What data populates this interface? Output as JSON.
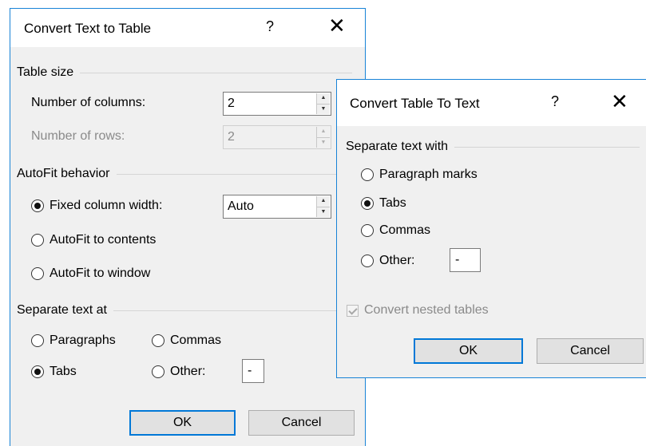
{
  "dialog1": {
    "title": "Convert Text to Table",
    "help": "?",
    "close": "✕",
    "table_size": {
      "heading": "Table size",
      "columns_label": "Number of columns:",
      "columns_value": "2",
      "rows_label": "Number of rows:",
      "rows_value": "2"
    },
    "autofit": {
      "heading": "AutoFit behavior",
      "fixed_label": "Fixed column width:",
      "fixed_value": "Auto",
      "contents_label": "AutoFit to contents",
      "window_label": "AutoFit to window",
      "selected": "fixed"
    },
    "separate": {
      "heading": "Separate text at",
      "paragraphs": "Paragraphs",
      "commas": "Commas",
      "tabs": "Tabs",
      "other": "Other:",
      "other_value": "-",
      "selected": "tabs"
    },
    "ok": "OK",
    "cancel": "Cancel"
  },
  "dialog2": {
    "title": "Convert Table To Text",
    "help": "?",
    "close": "✕",
    "heading": "Separate text with",
    "paragraph_marks": "Paragraph marks",
    "tabs": "Tabs",
    "commas": "Commas",
    "other": "Other:",
    "other_value": "-",
    "selected": "tabs",
    "nested_label": "Convert nested tables",
    "nested_checked": true,
    "ok": "OK",
    "cancel": "Cancel"
  }
}
